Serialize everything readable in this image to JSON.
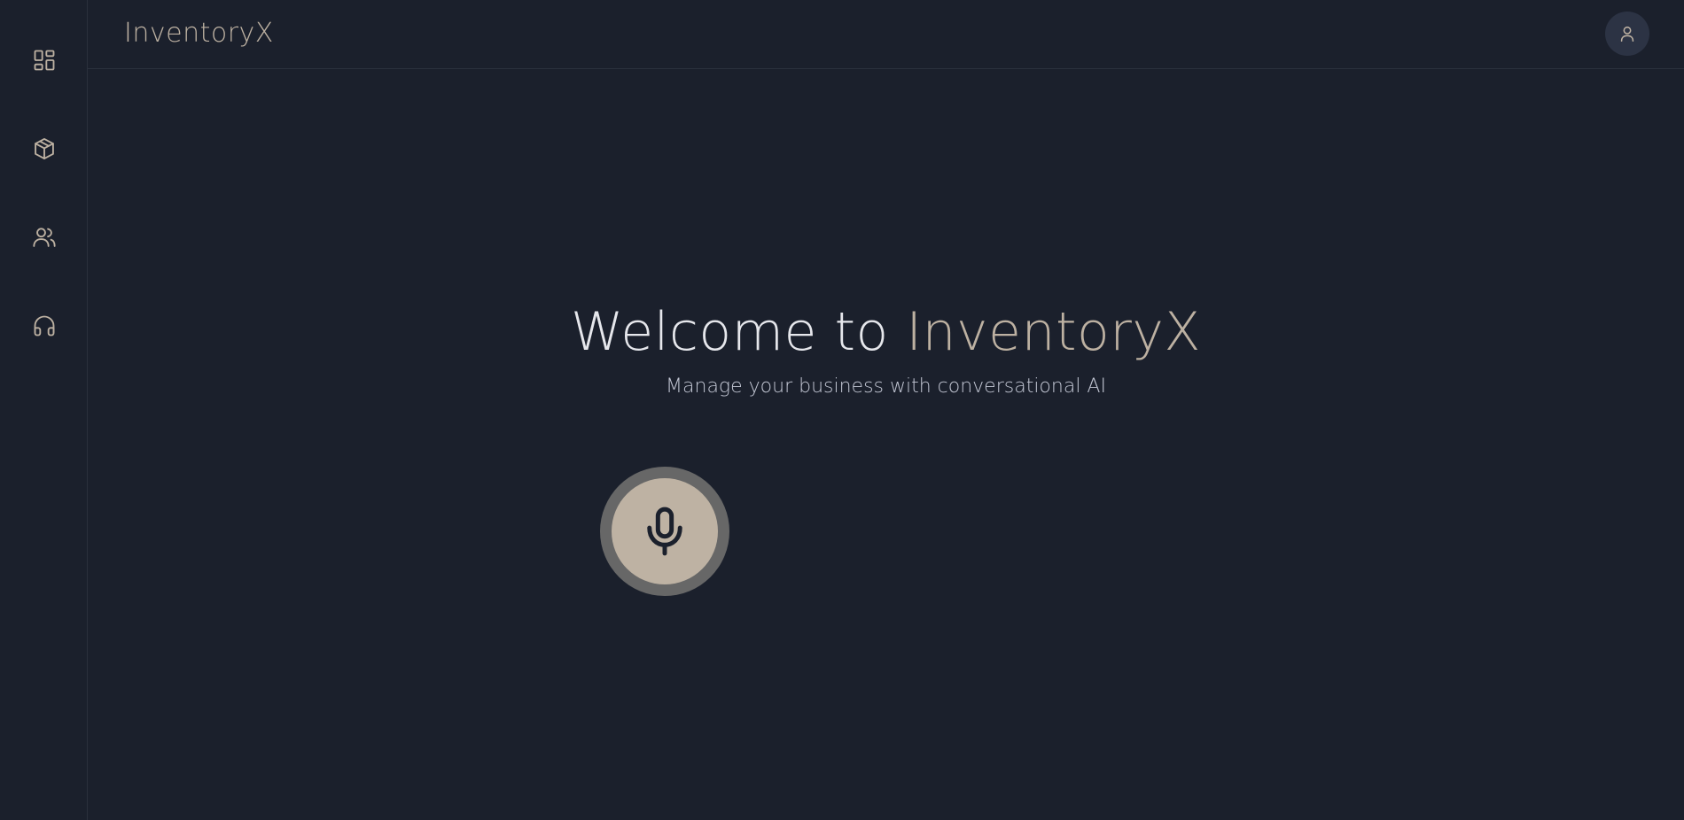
{
  "colors": {
    "background": "#1b202c",
    "accent": "#bdb1a2",
    "text_primary": "#e6e7ec",
    "text_secondary": "#c3c7d4",
    "mic_ring": "#676767"
  },
  "sidebar": {
    "items": [
      {
        "icon": "dashboard-icon"
      },
      {
        "icon": "package-icon"
      },
      {
        "icon": "users-icon"
      },
      {
        "icon": "headphones-icon"
      }
    ]
  },
  "header": {
    "app_title": "InventoryX",
    "avatar_icon": "user-icon"
  },
  "hero": {
    "title_prefix": "Welcome to ",
    "title_brand": "InventoryX",
    "subtitle": "Manage your business with conversational AI"
  },
  "voice": {
    "icon": "microphone-icon"
  }
}
